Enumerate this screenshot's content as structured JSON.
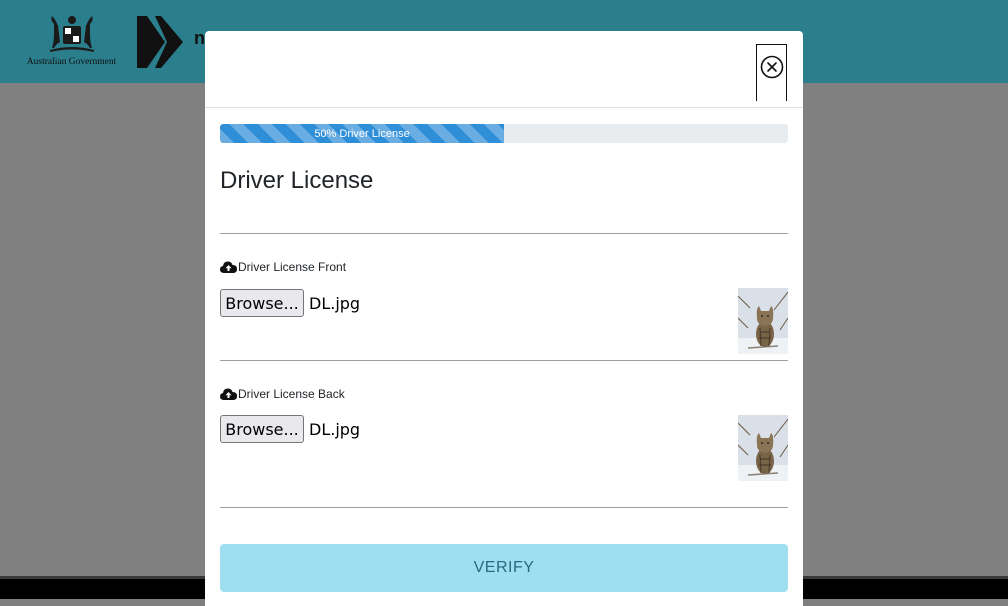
{
  "header": {
    "gov_text": "Australian Government",
    "brand_partial": "n"
  },
  "modal": {
    "progress": {
      "label": "50% Driver License",
      "percent": 50
    },
    "title": "Driver License",
    "fields": [
      {
        "label": "Driver License Front",
        "browse_label": "Browse...",
        "file_name": "DL.jpg",
        "icon": "cloud-upload-icon"
      },
      {
        "label": "Driver License Back",
        "browse_label": "Browse...",
        "file_name": "DL.jpg",
        "icon": "cloud-upload-icon"
      }
    ],
    "verify_label": "VERIFY"
  },
  "colors": {
    "topbar": "#2b7e8c",
    "progress": "#2f8ed8",
    "verify_bg": "#9fdff2",
    "verify_text": "#2b6a7e"
  }
}
